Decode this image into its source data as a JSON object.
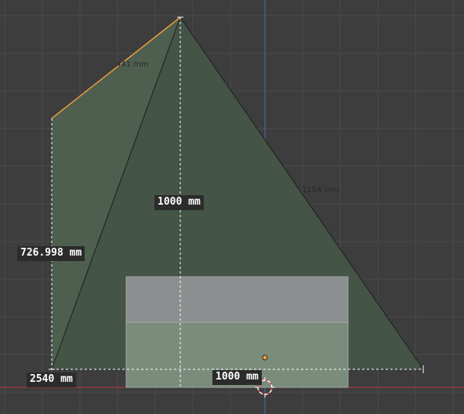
{
  "viewport": {
    "colors": {
      "background": "#3d3d3d",
      "grid": "#4a4a4a",
      "x_axis": "#c0393b",
      "z_axis": "#3f6fb6",
      "face_fill": "#4e5f50",
      "selected_edge": "#e89a3a",
      "box_top": "#8c8f8f",
      "box_bottom": "#7a8c7c"
    },
    "measurements": {
      "center_height": "1000 mm",
      "left_height": "726.998 mm",
      "bottom_left": "2540 mm",
      "bottom_center": "1000 mm"
    },
    "edge_lengths": {
      "top_left_edge": "441 mm",
      "right_edge": "1154 mm"
    },
    "icons": {
      "origin": "object-origin-icon",
      "cursor": "3d-cursor-icon"
    }
  }
}
